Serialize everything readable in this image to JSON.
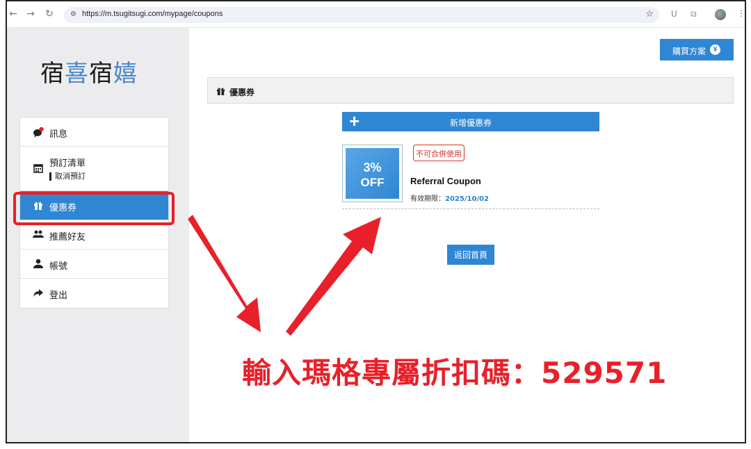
{
  "browser": {
    "url": "https://m.tsugitsugi.com/mypage/coupons"
  },
  "logo": {
    "chars": [
      "宿",
      "喜",
      "宿",
      "嬉"
    ]
  },
  "sidebar": {
    "items": [
      {
        "label": "訊息"
      },
      {
        "label": "預訂清單",
        "sub": "取消預訂"
      },
      {
        "label": "優惠券"
      },
      {
        "label": "推薦好友"
      },
      {
        "label": "帳號"
      },
      {
        "label": "登出"
      }
    ],
    "active_index": 2
  },
  "main": {
    "buy_button": "購買方案",
    "buy_icon": "¥",
    "section_title": "優惠券",
    "add_coupon": "新增優惠券",
    "coupon": {
      "discount_pct": "3%",
      "discount_off": "OFF",
      "tag": "不可合併使用",
      "name": "Referral Coupon",
      "validity_label": "有效期限：",
      "validity_date": "2025/10/02"
    },
    "home_button": "返回首頁"
  },
  "annotation": {
    "text": "輸入瑪格專屬折扣碼：529571",
    "color": "#e8202a"
  },
  "colors": {
    "accent": "#2f86d3",
    "annotation": "#e8202a",
    "sidebar_bg": "#ececee"
  }
}
